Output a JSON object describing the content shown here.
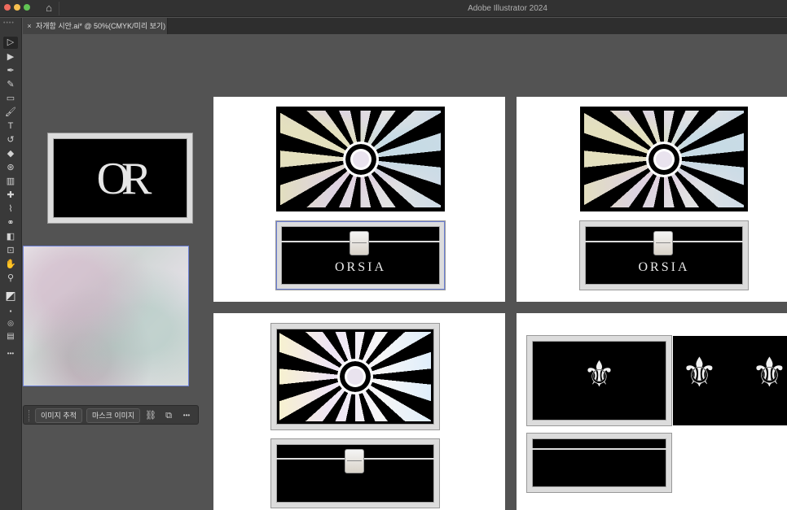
{
  "app": {
    "title": "Adobe Illustrator 2024",
    "home_icon": "home-icon"
  },
  "document_tab": {
    "close": "×",
    "label": "자개함 시안.ai* @ 50%(CMYK/미리 보기)"
  },
  "tools": [
    {
      "name": "selection-tool",
      "glyph": "▷"
    },
    {
      "name": "direct-selection-tool",
      "glyph": "▶"
    },
    {
      "name": "pen-tool",
      "glyph": "✒"
    },
    {
      "name": "curvature-tool",
      "glyph": "✎"
    },
    {
      "name": "rectangle-tool",
      "glyph": "▭"
    },
    {
      "name": "paintbrush-tool",
      "glyph": "🖌"
    },
    {
      "name": "type-tool",
      "glyph": "T"
    },
    {
      "name": "rotate-tool",
      "glyph": "↺"
    },
    {
      "name": "eraser-tool",
      "glyph": "◆"
    },
    {
      "name": "warp-tool",
      "glyph": "⊛"
    },
    {
      "name": "gradient-tool",
      "glyph": "▥"
    },
    {
      "name": "mesh-tool",
      "glyph": "✚"
    },
    {
      "name": "eyedropper-tool",
      "glyph": "⌇"
    },
    {
      "name": "blend-tool",
      "glyph": "⚭"
    },
    {
      "name": "shape-builder-tool",
      "glyph": "◧"
    },
    {
      "name": "artboard-tool",
      "glyph": "⊡"
    },
    {
      "name": "hand-tool",
      "glyph": "✋"
    },
    {
      "name": "zoom-tool",
      "glyph": "⚲"
    },
    {
      "name": "fill-stroke-swatch",
      "glyph": "◩"
    },
    {
      "name": "color-mode-buttons",
      "glyph": "▪"
    },
    {
      "name": "draw-mode-button",
      "glyph": "◎"
    },
    {
      "name": "screen-mode-button",
      "glyph": "▤"
    },
    {
      "name": "more-tools-button",
      "glyph": "•••"
    }
  ],
  "artwork": {
    "logo_text": "OR",
    "brand_text": "ORSIA"
  },
  "context_bar": {
    "image_trace": "이미지 추적",
    "mask_image": "마스크 이미지",
    "link_icon": "⛓",
    "crop_icon": "⧉",
    "more": "•••"
  }
}
